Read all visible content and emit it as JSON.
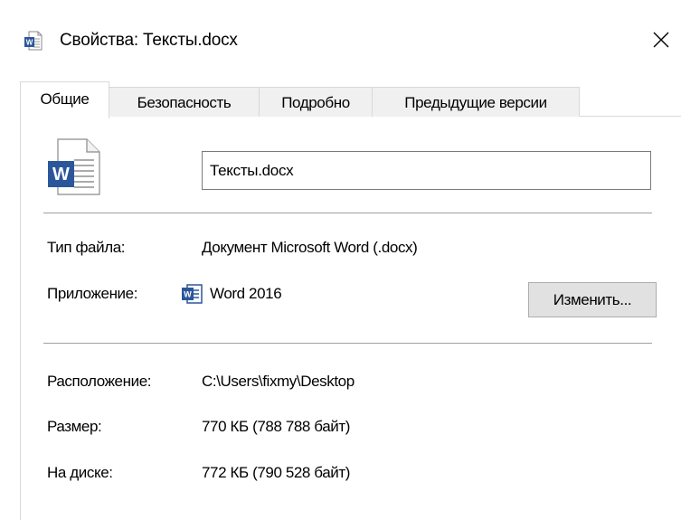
{
  "window": {
    "title": "Свойства: Тексты.docx",
    "title_icon": "word-document-icon",
    "close_icon": "close-icon"
  },
  "tabs": [
    {
      "label": "Общие",
      "active": true
    },
    {
      "label": "Безопасность",
      "active": false
    },
    {
      "label": "Подробно",
      "active": false
    },
    {
      "label": "Предыдущие версии",
      "active": false
    }
  ],
  "general": {
    "file_icon": "word-document-large-icon",
    "file_name": "Тексты.docx",
    "file_type_label": "Тип файла:",
    "file_type_value": "Документ Microsoft Word (.docx)",
    "app_label": "Приложение:",
    "app_icon": "word-app-icon",
    "app_value": "Word 2016",
    "change_button": "Изменить...",
    "location_label": "Расположение:",
    "location_value": "C:\\Users\\fixmy\\Desktop",
    "size_label": "Размер:",
    "size_value": "770 КБ (788 788 байт)",
    "disk_label": "На диске:",
    "disk_value": "772 КБ (790 528 байт)"
  },
  "colors": {
    "word_blue": "#2b579a",
    "tab_inactive": "#f0f0f0",
    "button_face": "#e1e1e1"
  }
}
